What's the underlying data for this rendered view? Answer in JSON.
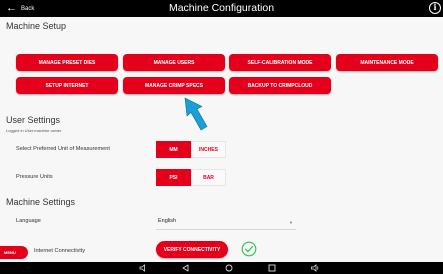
{
  "header": {
    "back_label": "Back",
    "title": "Machine Configuration",
    "info_glyph": "i"
  },
  "machine_setup": {
    "heading": "Machine Setup",
    "buttons": [
      "MANAGE PRESET DIES",
      "MANAGE USERS",
      "SELF-CALIBRATION MODE",
      "MAINTENANCE MODE",
      "SETUP INTERNET",
      "MANAGE CRIMP SPECS",
      "BACKUP TO CRIMPCLOUD"
    ]
  },
  "user_settings": {
    "heading": "User Settings",
    "logged_in": "Logged in User:machine owner",
    "unit_label": "Select Preferred Unit of Measurement",
    "unit_options": [
      "MM",
      "INCHES"
    ],
    "unit_selected": "MM",
    "pressure_label": "Pressure Units",
    "pressure_options": [
      "PSI",
      "BAR"
    ],
    "pressure_selected": "PSI"
  },
  "machine_settings": {
    "heading": "Machine Settings",
    "language_label": "Language",
    "language_value": "English",
    "internet_label": "Internet Connectivity",
    "verify_button": "VERIFY CONNECTIVITY"
  },
  "menu_tab": "MENU",
  "colors": {
    "accent": "#e4001b",
    "check": "#34c759",
    "pointer_arrow": "#1a9fd6"
  }
}
